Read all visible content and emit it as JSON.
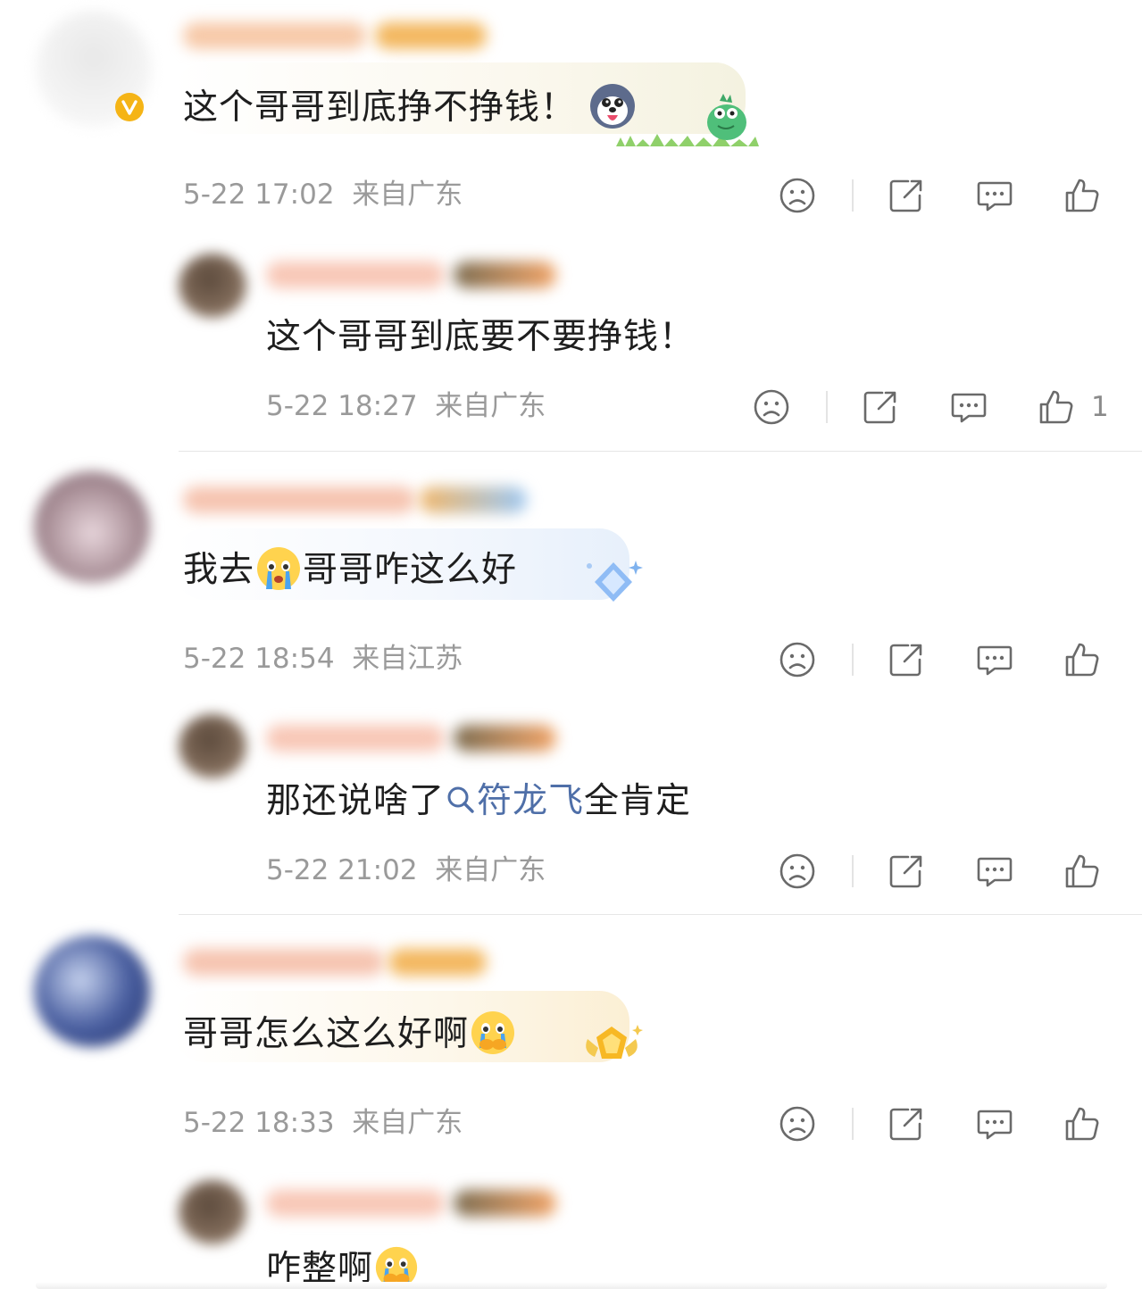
{
  "comments": [
    {
      "text": "这个哥哥到底挣不挣钱！",
      "time": "5-22 17:02",
      "location": "来自广东",
      "replies": [
        {
          "text": "这个哥哥到底要不要挣钱！",
          "time": "5-22 18:27",
          "location": "来自广东",
          "likes": "1"
        }
      ]
    },
    {
      "text_before": "我去",
      "text_after": "哥哥咋这么好",
      "time": "5-22 18:54",
      "location": "来自江苏",
      "replies": [
        {
          "text_before": "那还说啥了",
          "link": "符龙飞",
          "text_after": "全肯定",
          "time": "5-22 21:02",
          "location": "来自广东"
        }
      ]
    },
    {
      "text": "哥哥怎么这么好啊",
      "time": "5-22 18:33",
      "location": "来自广东",
      "replies": [
        {
          "text": "咋整啊"
        }
      ]
    }
  ],
  "icons": {
    "verified_badge": "v-badge-icon",
    "dislike": "sad-face-icon",
    "share": "share-icon",
    "comment": "comment-icon",
    "like": "thumbs-up-icon",
    "search": "search-icon"
  },
  "colors": {
    "link": "#4f6fa8",
    "meta": "#9a9a9a",
    "verified": "#f5b416"
  }
}
